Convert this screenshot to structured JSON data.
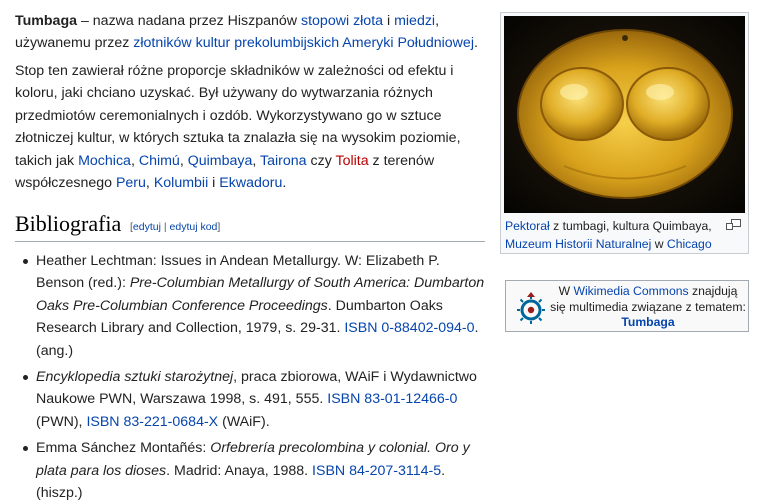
{
  "intro": {
    "term": "Tumbaga",
    "t1": " – nazwa nadana przez Hiszpanów ",
    "link_stop": "stopowi",
    "t2": " ",
    "link_zloto": "złota",
    "t3": " i ",
    "link_miedz": "miedzi",
    "t4": ", używanemu przez ",
    "link_zlotnikow": "złotników",
    "t5": " ",
    "link_kultur": "kultur prekolumbijskich",
    "t6": " ",
    "link_ameryki": "Ameryki Południowej",
    "t7": "."
  },
  "para2": {
    "t1": "Stop ten zawierał różne proporcje składników w zależności od efektu i koloru, jaki chciano uzyskać. Był używany do wytwarzania różnych przedmiotów ceremonialnych i ozdób. Wykorzystywano go w sztuce złotniczej kultur, w których sztuka ta znalazła się na wysokim poziomie, takich jak ",
    "link_mochica": "Mochica",
    "sep1": ", ",
    "link_chimu": "Chimú",
    "sep2": ", ",
    "link_quimbaya": "Quimbaya",
    "sep3": ", ",
    "link_tairona": "Tairona",
    "t2": " czy ",
    "link_tolita": "Tolita",
    "t3": " z terenów współczesnego ",
    "link_peru": "Peru",
    "sep4": ", ",
    "link_kolumbii": "Kolumbii",
    "t4": " i ",
    "link_ekwadoru": "Ekwadoru",
    "t5": "."
  },
  "thumb": {
    "link_pektoral": "Pektorał",
    "t1": " z tumbagi, kultura Quimbaya,",
    "link_muzeum": "Muzeum Historii Naturalnej",
    "t2": " w ",
    "link_chicago": "Chicago"
  },
  "section": {
    "title": "Bibliografia",
    "edit_open": "[",
    "edit_link1": "edytuj",
    "edit_sep": " | ",
    "edit_link2": "edytuj kod",
    "edit_close": "]"
  },
  "bibliography": [
    {
      "t1": "Heather Lechtman: Issues in Andean Metallurgy. W: Elizabeth P. Benson (red.): ",
      "italic": "Pre-Columbian Metallurgy of South America: Dumbarton Oaks Pre-Columbian Conference Proceedings",
      "t2": ". Dumbarton Oaks Research Library and Collection, 1979, s. 29-31. ",
      "isbn": "ISBN 0-88402-094-0",
      "t3": ". (ang.)"
    },
    {
      "italic": "Encyklopedia sztuki starożytnej",
      "t1": ", praca zbiorowa, WAiF i Wydawnictwo Naukowe PWN, Warszawa 1998, s. 491, 555. ",
      "isbn1": "ISBN 83-01-12466-0",
      "t2": " (PWN), ",
      "isbn2": "ISBN 83-221-0684-X",
      "t3": " (WAiF)."
    },
    {
      "t1": "Emma Sánchez Montañés: ",
      "italic": "Orfebrería precolombina y colonial. Oro y plata para los dioses",
      "t2": ". Madrid: Anaya, 1988. ",
      "isbn": "ISBN 84-207-3114-5",
      "t3": ". (hiszp.)"
    }
  ],
  "commons": {
    "t1": "W ",
    "link": "Wikimedia Commons",
    "t2": " znajdują się multimedia związane z tematem:",
    "topic": "Tumbaga"
  },
  "colors": {
    "link": "#0645ad",
    "redlink": "#ba0000",
    "gold": "#d4a017",
    "commons_red": "#9a1c1c",
    "commons_blue": "#006699"
  },
  "icons": {
    "magnify": "magnify-clip-icon",
    "commons": "wikimedia-commons-logo-icon"
  }
}
